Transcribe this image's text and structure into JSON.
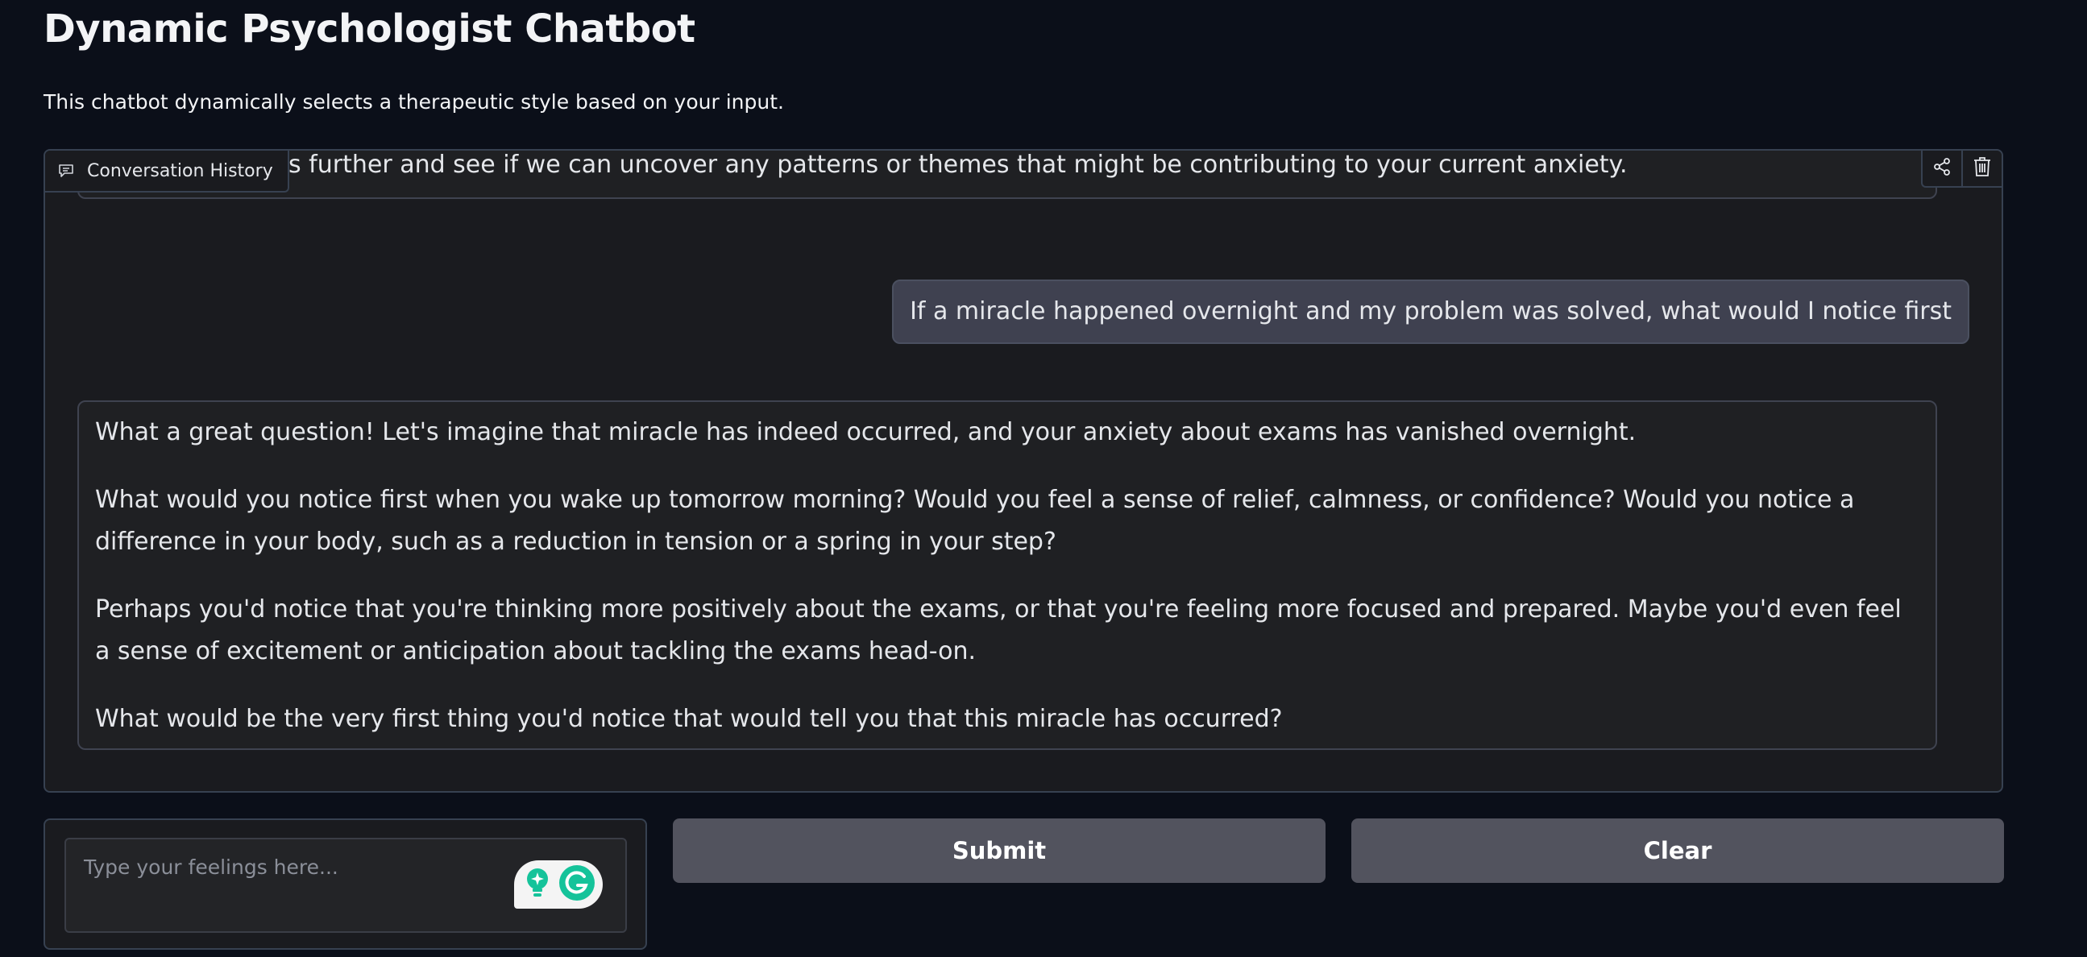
{
  "header": {
    "title": "Dynamic Psychologist Chatbot",
    "subtitle": "This chatbot dynamically selects a therapeutic style based on your input."
  },
  "chat": {
    "label": "Conversation History",
    "label_icon": "chat-bubble-icon",
    "action_icons": [
      "share-icon",
      "trash-icon"
    ],
    "messages": [
      {
        "role": "bot",
        "paragraphs": [
          "Let's explore this further and see if we can uncover any patterns or themes that might be contributing to your current anxiety."
        ]
      },
      {
        "role": "user",
        "paragraphs": [
          "If a miracle happened overnight and my problem was solved, what would I notice first"
        ]
      },
      {
        "role": "bot",
        "paragraphs": [
          "What a great question! Let's imagine that miracle has indeed occurred, and your anxiety about exams has vanished overnight.",
          "What would you notice first when you wake up tomorrow morning? Would you feel a sense of relief, calmness, or confidence? Would you notice a difference in your body, such as a reduction in tension or a spring in your step?",
          "Perhaps you'd notice that you're thinking more positively about the exams, or that you're feeling more focused and prepared. Maybe you'd even feel a sense of excitement or anticipation about tackling the exams head-on.",
          "What would be the very first thing you'd notice that would tell you that this miracle has occurred?"
        ]
      }
    ]
  },
  "input": {
    "value": "",
    "placeholder": "Type your feelings here...",
    "extension_icons": [
      "bulb-icon",
      "grammarly-icon"
    ]
  },
  "buttons": {
    "submit_label": "Submit",
    "clear_label": "Clear"
  },
  "colors": {
    "background": "#0b0f19",
    "panel": "#1a1b1f",
    "bot_bubble": "#1f2023",
    "user_bubble": "#3f4150",
    "button": "#52535e",
    "grammarly_green": "#15c39a"
  }
}
